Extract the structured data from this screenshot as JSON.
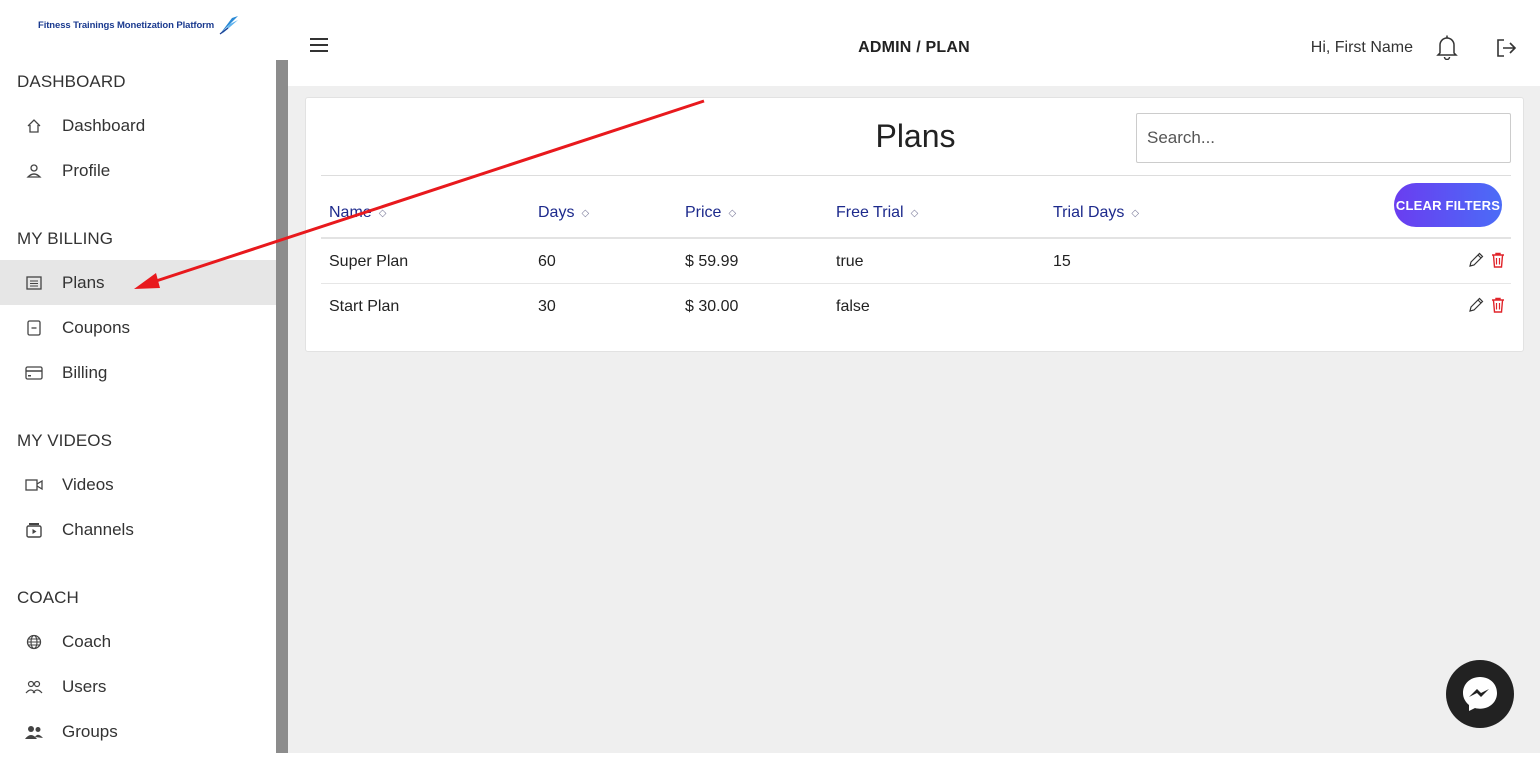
{
  "app": {
    "logo_text": "Fitness Trainings Monetization Platform"
  },
  "header": {
    "breadcrumb": "ADMIN / PLAN",
    "greeting": "Hi, First Name"
  },
  "sidebar": {
    "sections": [
      {
        "title": "DASHBOARD",
        "items": [
          {
            "label": "Dashboard",
            "icon": "home-icon"
          },
          {
            "label": "Profile",
            "icon": "user-icon"
          }
        ]
      },
      {
        "title": "MY BILLING",
        "items": [
          {
            "label": "Plans",
            "icon": "list-icon",
            "active": true
          },
          {
            "label": "Coupons",
            "icon": "coupon-icon"
          },
          {
            "label": "Billing",
            "icon": "credit-card-icon"
          }
        ]
      },
      {
        "title": "MY VIDEOS",
        "items": [
          {
            "label": "Videos",
            "icon": "video-camera-icon"
          },
          {
            "label": "Channels",
            "icon": "channel-icon"
          }
        ]
      },
      {
        "title": "COACH",
        "items": [
          {
            "label": "Coach",
            "icon": "globe-icon"
          },
          {
            "label": "Users",
            "icon": "users-icon"
          },
          {
            "label": "Groups",
            "icon": "group-icon"
          }
        ]
      }
    ]
  },
  "plans": {
    "title": "Plans",
    "search_placeholder": "Search...",
    "clear_filters_label": "CLEAR FILTERS",
    "columns": [
      "Name",
      "Days",
      "Price",
      "Free Trial",
      "Trial Days"
    ],
    "sort_glyph": "◇",
    "rows": [
      {
        "name": "Super Plan",
        "days": "60",
        "price": "$ 59.99",
        "free_trial": "true",
        "trial_days": "15"
      },
      {
        "name": "Start Plan",
        "days": "30",
        "price": "$ 30.00",
        "free_trial": "false",
        "trial_days": ""
      }
    ]
  },
  "colors": {
    "accent_gradient_start": "#6a3df0",
    "accent_gradient_end": "#4b6cf7",
    "header_link": "#1d2a8c",
    "delete_red": "#e0242a",
    "annotation_arrow": "#e8191d"
  }
}
